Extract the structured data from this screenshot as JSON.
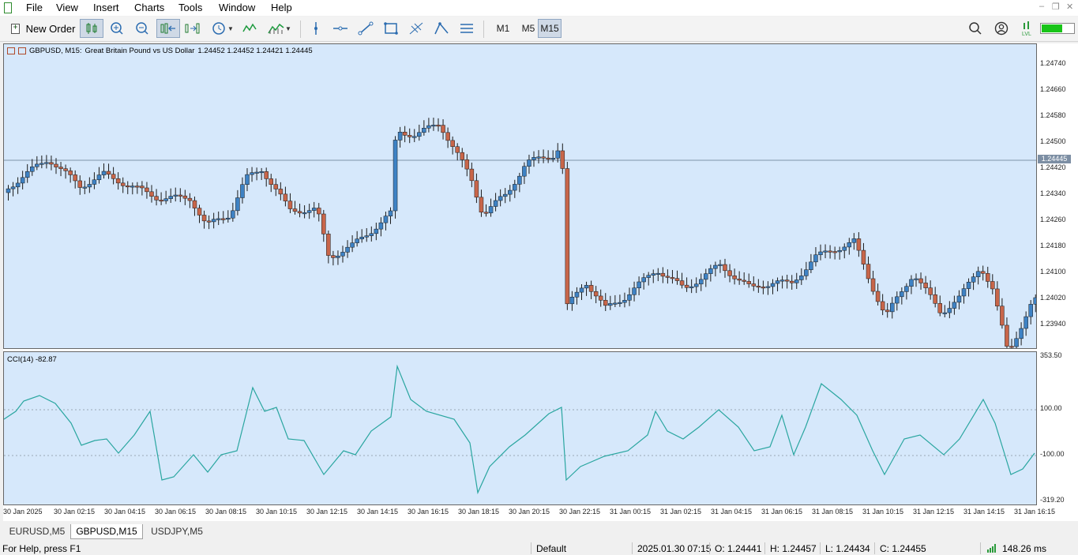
{
  "menu": [
    "File",
    "View",
    "Insert",
    "Charts",
    "Tools",
    "Window",
    "Help"
  ],
  "toolbar": {
    "new_order_label": "New Order",
    "timeframes": [
      "M1",
      "M5",
      "M15"
    ],
    "active_timeframe": "M15"
  },
  "chart": {
    "symbol": "GBPUSD, M15:",
    "description": "Great Britain Pound vs US Dollar",
    "ohlc": "1.24452 1.24452 1.24421 1.24445",
    "current_price_tag": "1.24445",
    "price_axis": [
      "1.24740",
      "1.24660",
      "1.24580",
      "1.24500",
      "1.24420",
      "1.24340",
      "1.24260",
      "1.24180",
      "1.24100",
      "1.24020",
      "1.23940"
    ],
    "time_axis": [
      "30 Jan 2025",
      "30 Jan 02:15",
      "30 Jan 04:15",
      "30 Jan 06:15",
      "30 Jan 08:15",
      "30 Jan 10:15",
      "30 Jan 12:15",
      "30 Jan 14:15",
      "30 Jan 16:15",
      "30 Jan 18:15",
      "30 Jan 20:15",
      "30 Jan 22:15",
      "31 Jan 00:15",
      "31 Jan 02:15",
      "31 Jan 04:15",
      "31 Jan 06:15",
      "31 Jan 08:15",
      "31 Jan 10:15",
      "31 Jan 12:15",
      "31 Jan 14:15",
      "31 Jan 16:15"
    ],
    "colors": {
      "bull": "#3e82c4",
      "bear": "#c8664a",
      "background": "#d6e8fb",
      "cci_line": "#2aa6a0"
    }
  },
  "indicator": {
    "title": "CCI(14) -82.87",
    "axis": [
      "353.50",
      "100.00",
      "-100.00",
      "-319.20"
    ]
  },
  "tabs": [
    "EURUSD,M5",
    "GBPUSD,M15",
    "USDJPY,M5"
  ],
  "active_tab": "GBPUSD,M15",
  "status": {
    "help": "For Help, press F1",
    "profile": "Default",
    "datetime": "2025.01.30 07:15",
    "open": "O: 1.24441",
    "high": "H: 1.24457",
    "low": "L: 1.24434",
    "close": "C: 1.24455",
    "ping": "148.26 ms"
  }
}
